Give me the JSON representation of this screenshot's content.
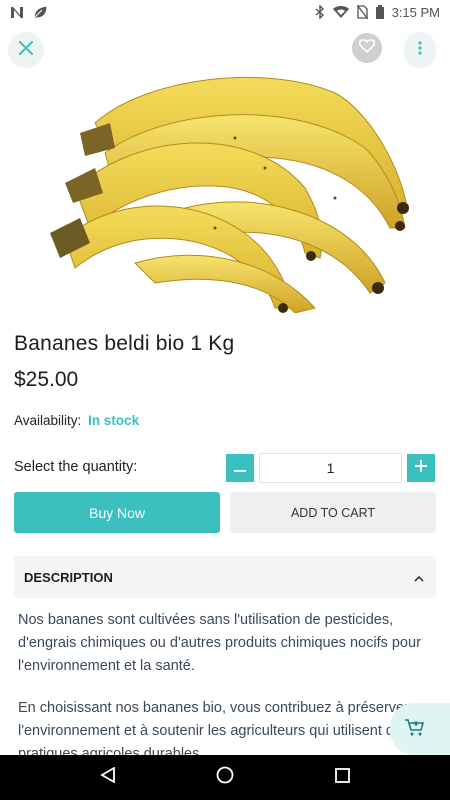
{
  "status_bar": {
    "time": "3:15 PM",
    "icons": [
      "notification-n-icon",
      "leaf-icon",
      "bluetooth-icon",
      "wifi-icon",
      "no-sim-icon",
      "battery-icon"
    ]
  },
  "toolbar": {
    "close_icon": "close-icon",
    "favorite_icon": "heart-icon",
    "more_icon": "more-vertical-icon"
  },
  "product": {
    "title": "Bananes beldi bio 1 Kg",
    "price": "$25.00",
    "availability_label": "Availability:",
    "availability_value": "In stock",
    "image": "bananas-photo"
  },
  "quantity": {
    "label": "Select the quantity:",
    "value": "1"
  },
  "actions": {
    "buy_now": "Buy Now",
    "add_to_cart": "ADD TO CART"
  },
  "description": {
    "header": "DESCRIPTION",
    "paragraphs": [
      "Nos bananes sont cultivées sans l'utilisation de pesticides, d'engrais chimiques ou d'autres produits chimiques nocifs pour l'environnement et la santé.",
      "En choisissant nos bananes bio, vous contribuez à préserver l'environnement et à soutenir les agriculteurs qui utilisent des pratiques agricoles durables."
    ]
  },
  "colors": {
    "accent": "#3bbfbf",
    "secondary_button": "#efefef",
    "panel": "#f4f5f7"
  }
}
